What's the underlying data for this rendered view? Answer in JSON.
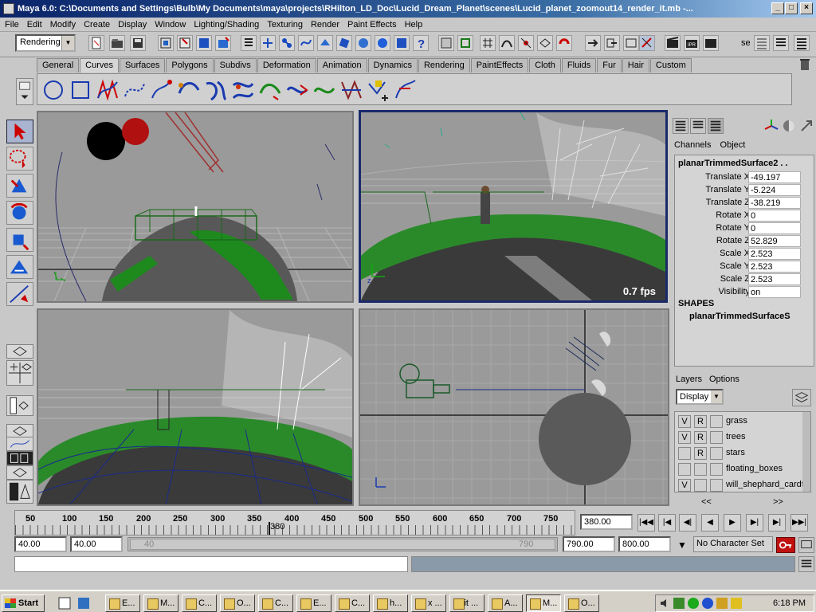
{
  "window": {
    "title": "Maya 6.0: C:\\Documents and Settings\\Bulb\\My Documents\\maya\\projects\\RHilton_LD_Doc\\Lucid_Dream_Planet\\scenes\\Lucid_planet_zoomout14_render_it.mb  -...",
    "min": "_",
    "max": "□",
    "close": "×"
  },
  "menu": [
    "File",
    "Edit",
    "Modify",
    "Create",
    "Display",
    "Window",
    "Lighting/Shading",
    "Texturing",
    "Render",
    "Paint Effects",
    "Help"
  ],
  "toolbar": {
    "mode": "Rendering",
    "se_label": "se"
  },
  "shelf_tabs": [
    "General",
    "Curves",
    "Surfaces",
    "Polygons",
    "Subdivs",
    "Deformation",
    "Animation",
    "Dynamics",
    "Rendering",
    "PaintEffects",
    "Cloth",
    "Fluids",
    "Fur",
    "Hair",
    "Custom"
  ],
  "shelf_active": "Curves",
  "viewport": {
    "fps": "0.7 fps"
  },
  "channel_box": {
    "tabs": [
      "Channels",
      "Object"
    ],
    "object": "planarTrimmedSurface2 . .",
    "attributes": [
      {
        "label": "Translate X",
        "value": "-49.197"
      },
      {
        "label": "Translate Y",
        "value": "-5.224"
      },
      {
        "label": "Translate Z",
        "value": "-38.219"
      },
      {
        "label": "Rotate X",
        "value": "0"
      },
      {
        "label": "Rotate Y",
        "value": "0"
      },
      {
        "label": "Rotate Z",
        "value": "52.829"
      },
      {
        "label": "Scale X",
        "value": "2.523"
      },
      {
        "label": "Scale Y",
        "value": "2.523"
      },
      {
        "label": "Scale Z",
        "value": "2.523"
      },
      {
        "label": "Visibility",
        "value": "on"
      }
    ],
    "shapes_header": "SHAPES",
    "shape": "planarTrimmedSurfaceS"
  },
  "layers": {
    "tabs": [
      "Layers",
      "Options"
    ],
    "display": "Display",
    "items": [
      {
        "v": "V",
        "r": "R",
        "name": "grass"
      },
      {
        "v": "V",
        "r": "R",
        "name": "trees"
      },
      {
        "v": "",
        "r": "R",
        "name": "stars"
      },
      {
        "v": "",
        "r": "",
        "name": "floating_boxes"
      },
      {
        "v": "V",
        "r": "",
        "name": "will_shephard_cardt"
      }
    ],
    "nav_left": "<<",
    "nav_right": ">>"
  },
  "timeline": {
    "ticks": [
      "50",
      "100",
      "150",
      "200",
      "250",
      "300",
      "350",
      "400",
      "450",
      "500",
      "550",
      "600",
      "650",
      "700",
      "750"
    ],
    "current_marker": "380",
    "current_frame": "380.00",
    "start": "40.00",
    "range_start": "40.00",
    "slider_start": "40",
    "slider_end": "790",
    "range_end": "790.00",
    "end": "800.00",
    "character_set": "No Character Set"
  },
  "taskbar": {
    "start": "Start",
    "tasks": [
      "E...",
      "M...",
      "C...",
      "O...",
      "C...",
      "E...",
      "C...",
      "h...",
      "x ...",
      "Edit ...",
      "A...",
      "M...",
      "O..."
    ],
    "clock": "6:18 PM"
  }
}
